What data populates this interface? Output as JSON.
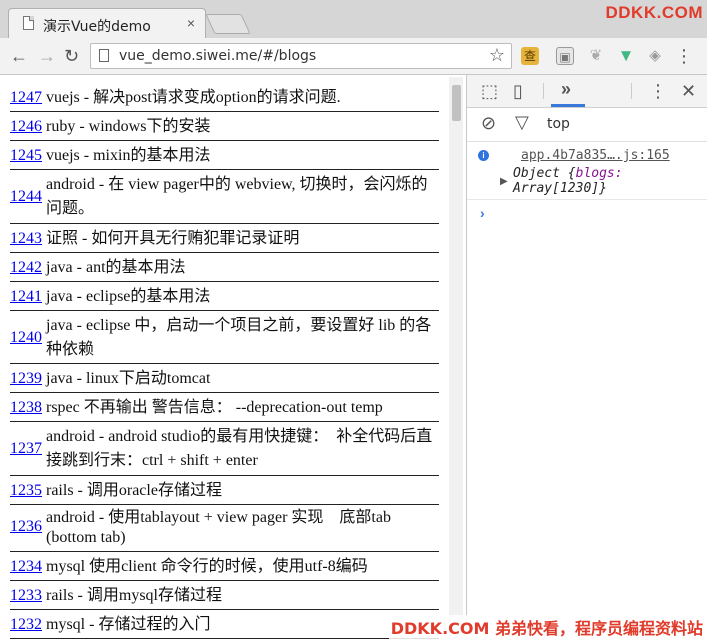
{
  "browser": {
    "tab_title": "演示Vue的demo",
    "tab_close": "×",
    "url": "vue_demo.siwei.me/#/blogs",
    "ext_cha": "查",
    "menu": "⋮"
  },
  "watermarks": {
    "top": "DDKK.COM",
    "bottom": "DDKK.COM 弟弟快看，程序员编程资料站"
  },
  "blogs": [
    {
      "id": "1247",
      "title": "vuejs - 解决post请求变成option的请求问题."
    },
    {
      "id": "1246",
      "title": "ruby - windows下的安装"
    },
    {
      "id": "1245",
      "title": "vuejs - mixin的基本用法"
    },
    {
      "id": "1244",
      "title": "android - 在 view pager中的 webview, 切换时，会闪烁的问题。"
    },
    {
      "id": "1243",
      "title": "证照 - 如何开具无行贿犯罪记录证明"
    },
    {
      "id": "1242",
      "title": "java - ant的基本用法"
    },
    {
      "id": "1241",
      "title": "java - eclipse的基本用法"
    },
    {
      "id": "1240",
      "title": "java - eclipse 中，启动一个项目之前，要设置好 lib 的各种依赖"
    },
    {
      "id": "1239",
      "title": "java - linux下启动tomcat"
    },
    {
      "id": "1238",
      "title": "rspec 不再输出 警告信息： --deprecation-out temp"
    },
    {
      "id": "1237",
      "title": "android - android studio的最有用快捷键：　补全代码后直接跳到行末：ctrl + shift + enter"
    },
    {
      "id": "1235",
      "title": "rails - 调用oracle存储过程"
    },
    {
      "id": "1236",
      "title": "android - 使用tablayout + view pager 实现　底部tab (bottom tab)"
    },
    {
      "id": "1234",
      "title": "mysql 使用client 命令行的时候，使用utf-8编码"
    },
    {
      "id": "1233",
      "title": "rails - 调用mysql存储过程"
    },
    {
      "id": "1232",
      "title": "mysql - 存储过程的入门"
    }
  ],
  "devtools": {
    "context": "top",
    "source": "app.4b7a835….js:165",
    "object_line1_prefix": "Object {",
    "object_key": "blogs:",
    "object_line2": "Array[1230]}",
    "prompt": "›"
  }
}
